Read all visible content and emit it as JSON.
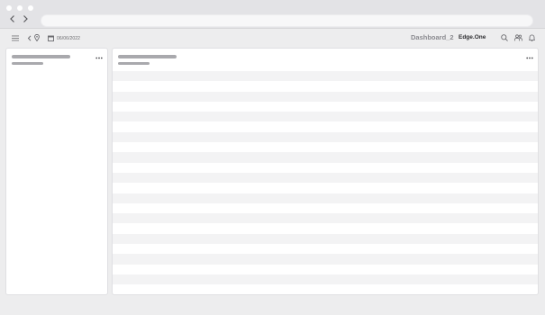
{
  "browser": {
    "back_icon": "chevron-left-icon",
    "forward_icon": "chevron-right-icon",
    "address_value": ""
  },
  "header": {
    "menu_icon": "hamburger-menu-icon",
    "collapse_icon": "chevron-left-icon",
    "location_icon": "map-pin-icon",
    "calendar_icon": "calendar-icon",
    "date": "06/06/2022",
    "dashboard_title": "Dashboard_2",
    "org_name": "Edge.One",
    "search_icon": "search-icon",
    "users_icon": "users-icon",
    "bell_icon": "bell-icon"
  },
  "panels": {
    "left": {
      "more_icon": "more-horizontal-icon"
    },
    "right": {
      "more_icon": "more-horizontal-icon",
      "row_count": 21
    }
  },
  "colors": {
    "chrome": "#e3e3e6",
    "background": "#ededee",
    "panel": "#ffffff",
    "skeleton": "#a9a9ad",
    "row_stripe": "#f3f3f4",
    "title_muted": "#8b8b90",
    "title_dark": "#2e2e31"
  }
}
